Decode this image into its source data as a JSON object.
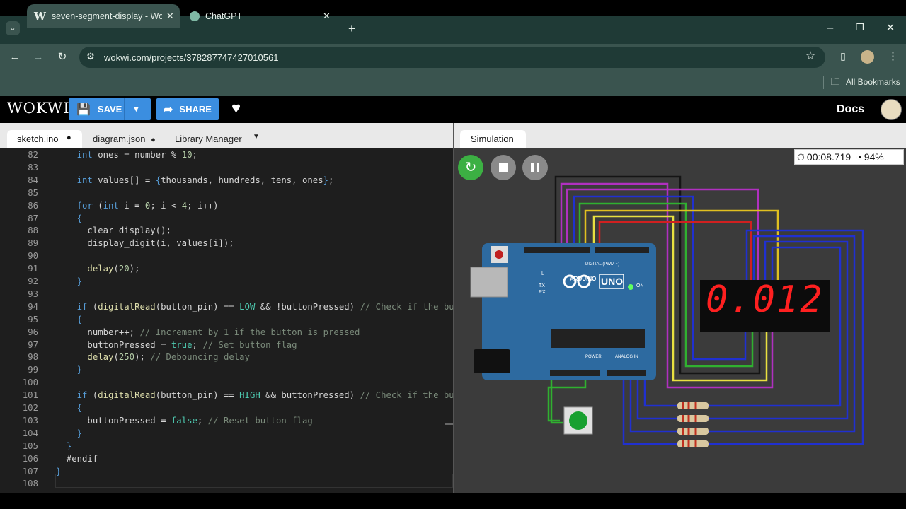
{
  "browser": {
    "tabs": [
      {
        "title": "seven-segment-display - Wokwi",
        "active": true
      },
      {
        "title": "ChatGPT",
        "active": false
      }
    ],
    "url": "wokwi.com/projects/378287747427010561",
    "bookmarks_label": "All Bookmarks"
  },
  "wokwi": {
    "logo": "WOKWI",
    "save_label": "SAVE",
    "share_label": "SHARE",
    "docs_label": "Docs"
  },
  "editor": {
    "tabs": [
      {
        "label": "sketch.ino",
        "modified": true,
        "active": true
      },
      {
        "label": "diagram.json",
        "modified": true,
        "active": false
      },
      {
        "label": "Library Manager",
        "modified": false,
        "active": false
      }
    ],
    "lines": [
      {
        "n": "82",
        "t": "    int ones = number % 10;"
      },
      {
        "n": "83",
        "t": ""
      },
      {
        "n": "84",
        "t": "    int values[] = {thousands, hundreds, tens, ones};"
      },
      {
        "n": "85",
        "t": ""
      },
      {
        "n": "86",
        "t": "    for (int i = 0; i < 4; i++)"
      },
      {
        "n": "87",
        "t": "    {"
      },
      {
        "n": "88",
        "t": "      clear_display();"
      },
      {
        "n": "89",
        "t": "      display_digit(i, values[i]);"
      },
      {
        "n": "90",
        "t": ""
      },
      {
        "n": "91",
        "t": "      delay(20);"
      },
      {
        "n": "92",
        "t": "    }"
      },
      {
        "n": "93",
        "t": ""
      },
      {
        "n": "94",
        "t": "    if (digitalRead(button_pin) == LOW && !buttonPressed) // Check if the butt"
      },
      {
        "n": "95",
        "t": "    {"
      },
      {
        "n": "96",
        "t": "      number++; // Increment by 1 if the button is pressed"
      },
      {
        "n": "97",
        "t": "      buttonPressed = true; // Set button flag"
      },
      {
        "n": "98",
        "t": "      delay(250); // Debouncing delay"
      },
      {
        "n": "99",
        "t": "    }"
      },
      {
        "n": "100",
        "t": ""
      },
      {
        "n": "101",
        "t": "    if (digitalRead(button_pin) == HIGH && buttonPressed) // Check if the butt"
      },
      {
        "n": "102",
        "t": "    {"
      },
      {
        "n": "103",
        "t": "      buttonPressed = false; // Reset button flag"
      },
      {
        "n": "104",
        "t": "    }"
      },
      {
        "n": "105",
        "t": "  }"
      },
      {
        "n": "106",
        "t": "  #endif"
      },
      {
        "n": "107",
        "t": "}"
      },
      {
        "n": "108",
        "t": ""
      }
    ]
  },
  "simulation": {
    "tab_label": "Simulation",
    "timer": "00:08.719",
    "speed": "94%",
    "display_digits": "0.012",
    "board": {
      "uno": "UNO",
      "arduino": "ARDUINO",
      "on": "ON",
      "tx": "TX",
      "rx": "RX",
      "l": "L",
      "digital": "DIGITAL (PWM ~)",
      "power": "POWER",
      "analog": "ANALOG IN"
    }
  },
  "colors": {
    "accent": "#3b8ee0",
    "board": "#2d6aa0",
    "segment_on": "#ff2020",
    "segment_off": "#3a0a0a"
  }
}
